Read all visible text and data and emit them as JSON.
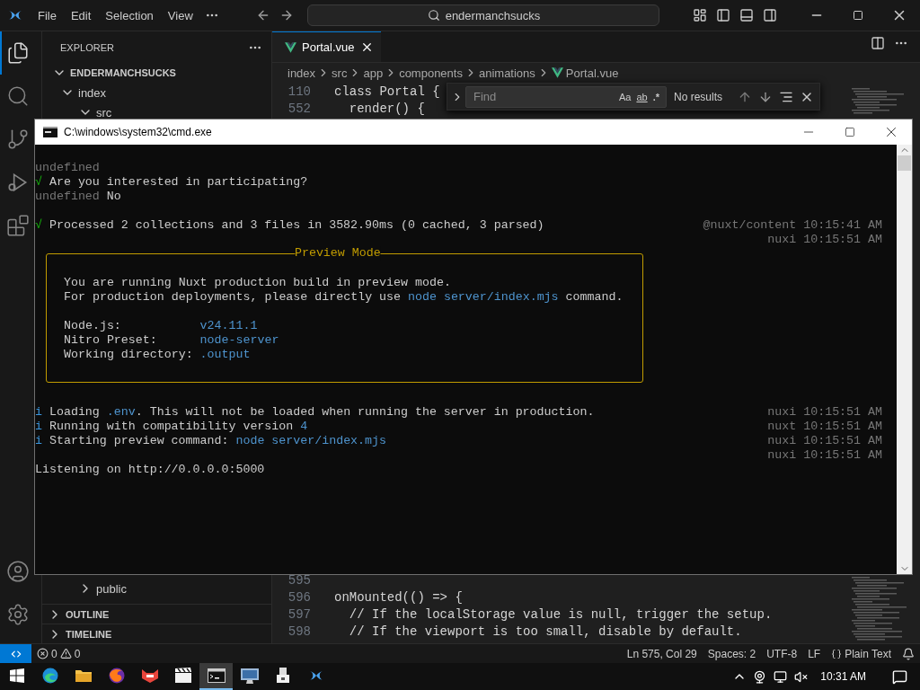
{
  "vscode": {
    "menu": [
      "File",
      "Edit",
      "Selection",
      "View"
    ],
    "command_center": "endermanchsucks",
    "activity_bar": [
      {
        "kind": "explorer",
        "selected": true
      },
      {
        "kind": "search",
        "selected": false
      },
      {
        "kind": "source-control",
        "selected": false
      },
      {
        "kind": "run",
        "selected": false
      },
      {
        "kind": "extensions",
        "selected": false
      }
    ],
    "activity_bar_bottom": [
      {
        "kind": "account"
      },
      {
        "kind": "settings"
      }
    ],
    "sidebar": {
      "title": "EXPLORER",
      "tree": [
        {
          "label": "ENDERMANCHSUCKS",
          "expanded": true,
          "children": [
            {
              "label": "index",
              "expanded": true,
              "children": [
                {
                  "label": "src",
                  "expanded": true
                }
              ]
            }
          ]
        }
      ],
      "tree_continued": [
        {
          "label": "public",
          "expanded": false
        }
      ],
      "sections": [
        {
          "label": "OUTLINE",
          "expanded": false
        },
        {
          "label": "TIMELINE",
          "expanded": false
        }
      ]
    },
    "tabs": [
      {
        "label": "Portal.vue",
        "selected": true
      }
    ],
    "breadcrumbs": [
      "index",
      "src",
      "app",
      "components",
      "animations",
      "Portal.vue"
    ],
    "code_top": [
      {
        "line": "110",
        "text": "class Portal {"
      },
      {
        "line": "552",
        "text": "  render() {"
      }
    ],
    "code_bottom": [
      {
        "line": "595"
      },
      {
        "line": "596",
        "text": "onMounted(() => {"
      },
      {
        "line": "597",
        "text": "  // If the localStorage value is null, trigger the setup."
      },
      {
        "line": "598",
        "text": "  // If the viewport is too small, disable by default."
      }
    ],
    "find": {
      "placeholder": "Find",
      "options": [
        "Aa",
        "ab",
        ".*"
      ],
      "result": "No results"
    },
    "status_bar": {
      "errors": "0",
      "warnings": "0",
      "items": [
        "Ln 575, Col 29",
        "Spaces: 2",
        "UTF-8",
        "LF"
      ],
      "language": "Plain Text"
    }
  },
  "cmd": {
    "title": "C:\\windows\\system32\\cmd.exe",
    "output": [
      {
        "kind": "line",
        "segments": [
          {
            "kind": "dim",
            "text": "undefined"
          }
        ]
      },
      {
        "kind": "line",
        "segments": [
          {
            "kind": "success",
            "text": "√"
          },
          {
            "kind": "plain",
            "text": " Are you interested in participating?"
          }
        ]
      },
      {
        "kind": "line",
        "segments": [
          {
            "kind": "dim",
            "text": "undefined"
          },
          {
            "kind": "plain",
            "text": " No"
          }
        ]
      },
      {
        "kind": "blank"
      },
      {
        "kind": "line",
        "segments": [
          {
            "kind": "success",
            "text": "√"
          },
          {
            "kind": "plain",
            "text": " Processed 2 collections and 3 files in 3582.90ms (0 cached, 3 parsed)"
          }
        ],
        "right": "@nuxt/content 10:15:41 AM"
      },
      {
        "kind": "line",
        "right": "nuxi 10:15:51 AM"
      },
      {
        "kind": "box",
        "title": "Preview Mode",
        "lines": [
          {
            "kind": "blank"
          },
          {
            "kind": "text",
            "segments": [
              {
                "kind": "plain",
                "text": "You are running Nuxt production build in preview mode."
              }
            ]
          },
          {
            "kind": "text",
            "segments": [
              {
                "kind": "plain",
                "text": "For production deployments, please directly use "
              },
              {
                "kind": "link",
                "text": "node server/index.mjs"
              },
              {
                "kind": "plain",
                "text": " command."
              }
            ]
          },
          {
            "kind": "blank"
          },
          {
            "kind": "field",
            "label": "Node.js:",
            "value": "v24.11.1"
          },
          {
            "kind": "field",
            "label": "Nitro Preset:",
            "value": "node-server"
          },
          {
            "kind": "field",
            "label": "Working directory:",
            "value": ".output"
          },
          {
            "kind": "blank"
          }
        ]
      },
      {
        "kind": "blank"
      },
      {
        "kind": "line",
        "segments": [
          {
            "kind": "info",
            "text": "i"
          },
          {
            "kind": "plain",
            "text": " Loading "
          },
          {
            "kind": "link",
            "text": ".env"
          },
          {
            "kind": "plain",
            "text": ". This will not be loaded when running the server in production."
          }
        ],
        "right": "nuxi 10:15:51 AM"
      },
      {
        "kind": "line",
        "segments": [
          {
            "kind": "info",
            "text": "i"
          },
          {
            "kind": "plain",
            "text": " Running with compatibility version "
          },
          {
            "kind": "link",
            "text": "4"
          }
        ],
        "right": "nuxt 10:15:51 AM"
      },
      {
        "kind": "line",
        "segments": [
          {
            "kind": "info",
            "text": "i"
          },
          {
            "kind": "plain",
            "text": " Starting preview command: "
          },
          {
            "kind": "link",
            "text": "node server/index.mjs"
          }
        ],
        "right": "nuxi 10:15:51 AM"
      },
      {
        "kind": "line",
        "right": "nuxi 10:15:51 AM"
      },
      {
        "kind": "line",
        "segments": [
          {
            "kind": "plain",
            "text": "Listening on http://0.0.0.0:5000"
          }
        ]
      }
    ]
  },
  "taskbar": {
    "apps": [
      {
        "kind": "browser",
        "selected": false
      },
      {
        "kind": "folder",
        "selected": false
      },
      {
        "kind": "fox",
        "selected": false
      },
      {
        "kind": "red-app",
        "selected": false
      },
      {
        "kind": "clapper",
        "selected": false
      },
      {
        "kind": "terminal",
        "selected": true
      },
      {
        "kind": "monitor",
        "selected": false
      },
      {
        "kind": "device",
        "selected": false
      },
      {
        "kind": "editor",
        "selected": false
      }
    ],
    "clock": "10:31 AM"
  }
}
